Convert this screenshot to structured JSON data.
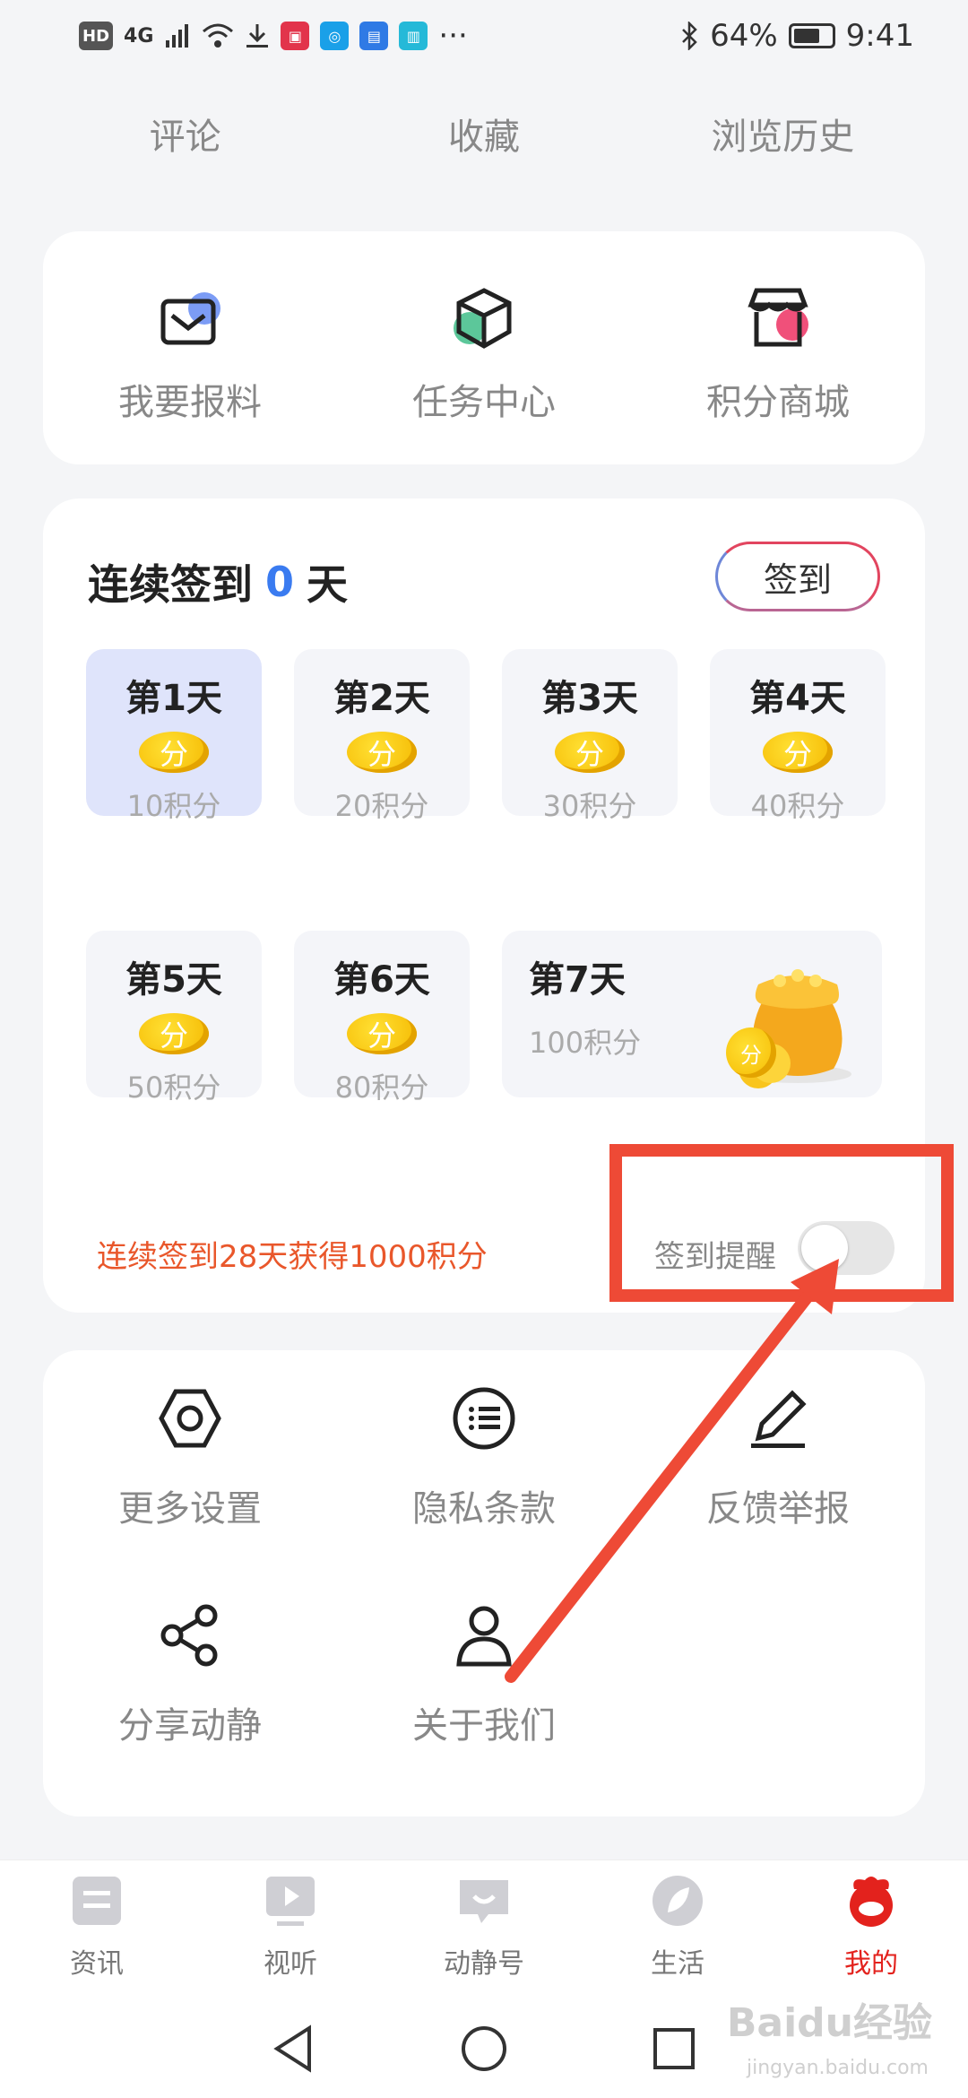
{
  "status_bar": {
    "left_badge": "HD",
    "network": "4G",
    "battery": "64%",
    "time": "9:41",
    "more": "···"
  },
  "stats": [
    "评论",
    "收藏",
    "浏览历史"
  ],
  "features": [
    {
      "label": "我要报料",
      "icon": "envelope-icon"
    },
    {
      "label": "任务中心",
      "icon": "box-icon"
    },
    {
      "label": "积分商城",
      "icon": "store-icon"
    }
  ],
  "signin": {
    "title_prefix": "连续签到",
    "count": "0",
    "title_suffix": "天",
    "button": "签到",
    "coin_char": "分",
    "days": [
      {
        "title": "第1天",
        "points": "10积分",
        "active": true
      },
      {
        "title": "第2天",
        "points": "20积分"
      },
      {
        "title": "第3天",
        "points": "30积分"
      },
      {
        "title": "第4天",
        "points": "40积分"
      },
      {
        "title": "第5天",
        "points": "50积分"
      },
      {
        "title": "第6天",
        "points": "80积分"
      },
      {
        "title": "第7天",
        "points": "100积分"
      }
    ],
    "streak_reward": "连续签到28天获得1000积分",
    "remind_label": "签到提醒",
    "remind_on": false
  },
  "settings": [
    {
      "label": "更多设置",
      "icon": "hexagon-nut-icon"
    },
    {
      "label": "隐私条款",
      "icon": "list-icon"
    },
    {
      "label": "反馈举报",
      "icon": "pen-icon"
    },
    {
      "label": "分享动静",
      "icon": "share-icon"
    },
    {
      "label": "关于我们",
      "icon": "person-icon"
    }
  ],
  "bottom_nav": [
    {
      "label": "资讯",
      "icon": "news-icon"
    },
    {
      "label": "视听",
      "icon": "video-icon"
    },
    {
      "label": "动静号",
      "icon": "chat-icon"
    },
    {
      "label": "生活",
      "icon": "leaf-icon"
    },
    {
      "label": "我的",
      "icon": "mascot-icon",
      "active": true
    }
  ],
  "watermark": {
    "main": "Baidu经验",
    "sub": "jingyan.baidu.com"
  },
  "colors": {
    "accent_red": "#e3221d",
    "annotation": "#ee4a36",
    "count_blue": "#3a7bf0",
    "coin": "#f5b800"
  }
}
